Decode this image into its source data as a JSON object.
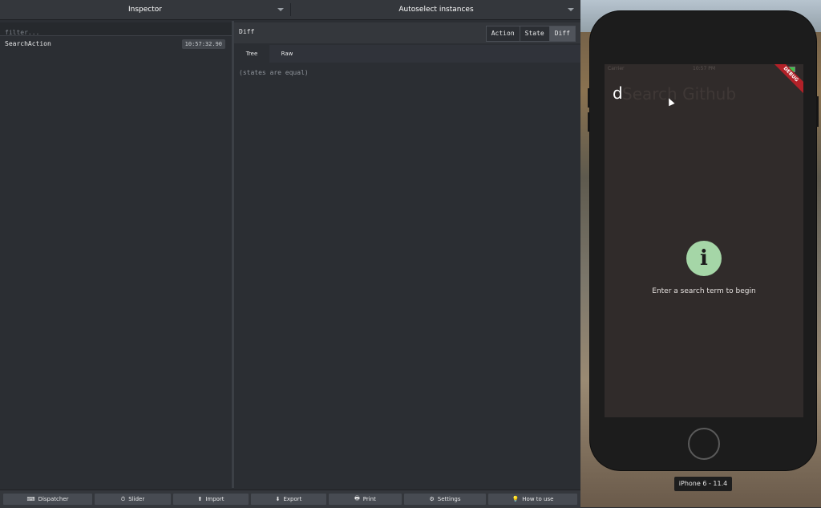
{
  "topbar": {
    "left_dropdown": "Inspector",
    "right_dropdown": "Autoselect instances"
  },
  "action_list": {
    "filter_placeholder": "filter...",
    "items": [
      {
        "name": "SearchAction",
        "time": "10:57:32.90"
      }
    ]
  },
  "detail": {
    "title": "Diff",
    "modes": [
      "Action",
      "State",
      "Diff"
    ],
    "active_mode": "Diff",
    "tabs": [
      "Tree",
      "Raw"
    ],
    "active_tab": "Tree",
    "message": "(states are equal)"
  },
  "bottombar": {
    "buttons": [
      {
        "label": "Dispatcher",
        "icon": "keyboard-icon",
        "glyph": "⌨"
      },
      {
        "label": "Slider",
        "icon": "timer-icon",
        "glyph": "⏱"
      },
      {
        "label": "Import",
        "icon": "upload-icon",
        "glyph": "⬆"
      },
      {
        "label": "Export",
        "icon": "download-icon",
        "glyph": "⬇"
      },
      {
        "label": "Print",
        "icon": "printer-icon",
        "glyph": "🖶"
      },
      {
        "label": "Settings",
        "icon": "gear-icon",
        "glyph": "⚙"
      },
      {
        "label": "How to use",
        "icon": "lightbulb-icon",
        "glyph": "💡"
      }
    ]
  },
  "simulator": {
    "carrier": "Carrier",
    "clock": "10:57 PM",
    "debug_banner": "DEBUG",
    "typed_text": "d",
    "ghost_text": "Search Github",
    "info_glyph": "i",
    "hint": "Enter a search term to begin",
    "device_label": "iPhone 6 - 11.4"
  },
  "colors": {
    "panel_bg": "#2b2e33",
    "info_circle": "#a5d6a7",
    "debug_banner": "#b22128",
    "battery": "#3ec24a"
  }
}
